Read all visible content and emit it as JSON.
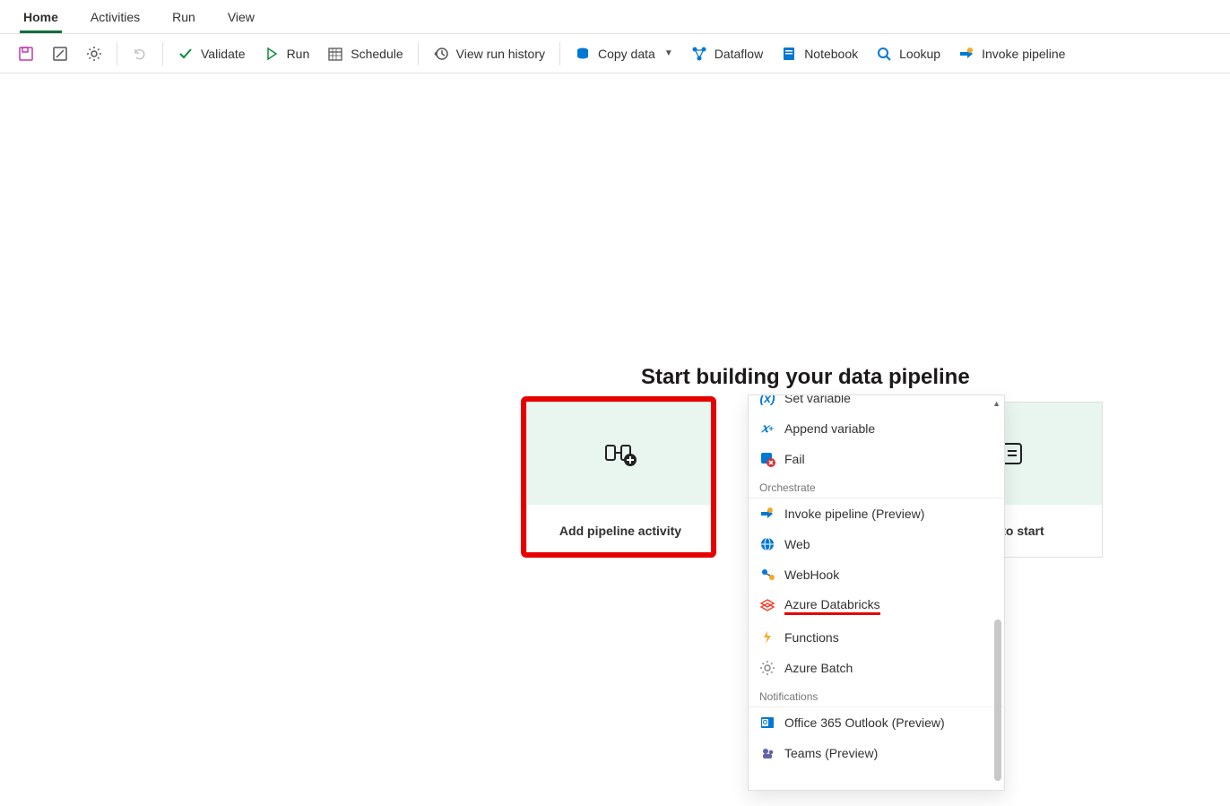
{
  "tabs": {
    "items": [
      {
        "label": "Home",
        "active": true
      },
      {
        "label": "Activities",
        "active": false
      },
      {
        "label": "Run",
        "active": false
      },
      {
        "label": "View",
        "active": false
      }
    ]
  },
  "toolbar": {
    "validate": "Validate",
    "run": "Run",
    "schedule": "Schedule",
    "view_run_history": "View run history",
    "copy_data": "Copy data",
    "dataflow": "Dataflow",
    "notebook": "Notebook",
    "lookup": "Lookup",
    "invoke_pipeline": "Invoke pipeline"
  },
  "canvas": {
    "heading": "Start building your data pipeline",
    "tile_a_label": "Add pipeline activity",
    "tile_c_label": "task to start"
  },
  "dropdown": {
    "cut_item": "Set variable",
    "items_top": [
      {
        "label": "Append variable",
        "icon": "append-var-icon"
      },
      {
        "label": "Fail",
        "icon": "fail-icon"
      }
    ],
    "section_orchestrate": "Orchestrate",
    "items_orch": [
      {
        "label": "Invoke pipeline (Preview)",
        "icon": "invoke-pipeline-icon"
      },
      {
        "label": "Web",
        "icon": "web-icon"
      },
      {
        "label": "WebHook",
        "icon": "webhook-icon"
      },
      {
        "label": "Azure Databricks",
        "icon": "databricks-icon",
        "underline": true
      },
      {
        "label": "Functions",
        "icon": "functions-icon"
      },
      {
        "label": "Azure Batch",
        "icon": "batch-icon"
      }
    ],
    "section_notifications": "Notifications",
    "items_notif": [
      {
        "label": "Office 365 Outlook (Preview)",
        "icon": "outlook-icon"
      },
      {
        "label": "Teams (Preview)",
        "icon": "teams-icon"
      }
    ]
  }
}
